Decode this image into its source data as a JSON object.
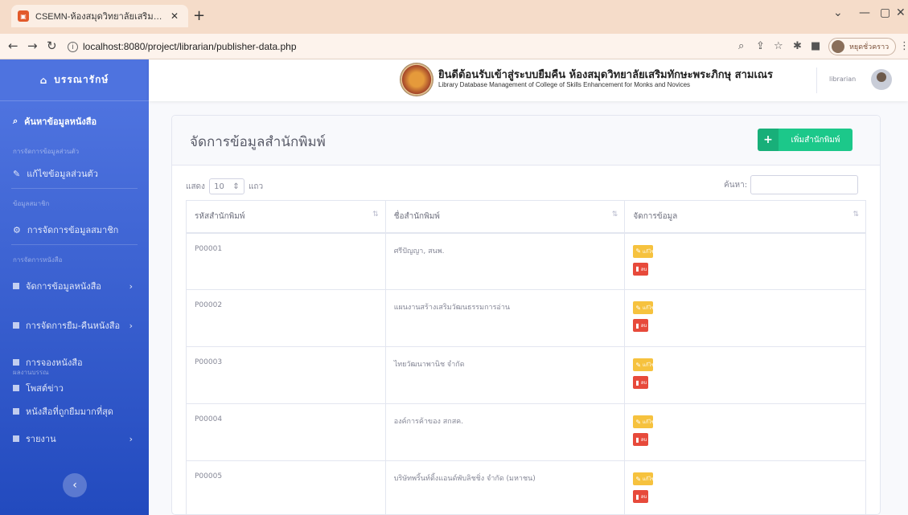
{
  "browser": {
    "tab_title": "CSEMN-ห้องสมุดวิทยาลัยเสริมทักษะพร",
    "url": "localhost:8080/project/librarian/publisher-data.php",
    "profile_label": "หยุดชั่วคราว"
  },
  "sidebar": {
    "brand": "บรรณารักษ์",
    "items": [
      {
        "label": "ค้นหาข้อมูลหนังสือ"
      },
      {
        "label": "แก้ไขข้อมูลส่วนตัว"
      },
      {
        "label": "การจัดการข้อมูลสมาชิก"
      },
      {
        "label": "จัดการข้อมูลหนังสือ"
      },
      {
        "label": "การจัดการยืม-คืนหนังสือ"
      },
      {
        "label": "การจองหนังสือ"
      },
      {
        "label": "โพสต์ข่าว"
      },
      {
        "label": "หนังสือที่ถูกยืมมากที่สุด"
      },
      {
        "label": "รายงาน"
      }
    ],
    "headings": [
      "การจัดการข้อมูลส่วนตัว",
      "ข้อมูลสมาชิก",
      "การจัดการหนังสือ",
      "ผลงานบรรณ"
    ]
  },
  "topbar": {
    "title": "ยินดีต้อนรับเข้าสู่ระบบยืมคืน ห้องสมุดวิทยาลัยเสริมทักษะพระภิกษุ สามเณร",
    "subtitle": "Library Database Management of College of Skills Enhancement for Monks and Novices",
    "user": "librarian"
  },
  "card": {
    "title": "จัดการข้อมูลสำนักพิมพ์",
    "add_button": "เพิ่มสำนักพิมพ์"
  },
  "table_controls": {
    "show_prefix": "แสดง",
    "page_length": "10",
    "show_suffix": "แถว",
    "search_label": "ค้นหา:"
  },
  "table": {
    "headers": [
      "รหัสสำนักพิมพ์",
      "ชื่อสำนักพิมพ์",
      "จัดการข้อมูล"
    ],
    "rows": [
      {
        "id": "P00001",
        "name": "ศรีปัญญา, สนพ."
      },
      {
        "id": "P00002",
        "name": "แผนงานสร้างเสริมวัฒนธรรมการอ่าน"
      },
      {
        "id": "P00003",
        "name": "ไทยวัฒนาพานิช จำกัด"
      },
      {
        "id": "P00004",
        "name": "องค์การค้าของ สกสค."
      },
      {
        "id": "P00005",
        "name": "บริษัทพริ้นท์ติ้งแอนด์พับลิชชิ่ง จำกัด (มหาชน)"
      }
    ],
    "edit_label": "แก้ไข",
    "delete_label": "ลบ"
  }
}
